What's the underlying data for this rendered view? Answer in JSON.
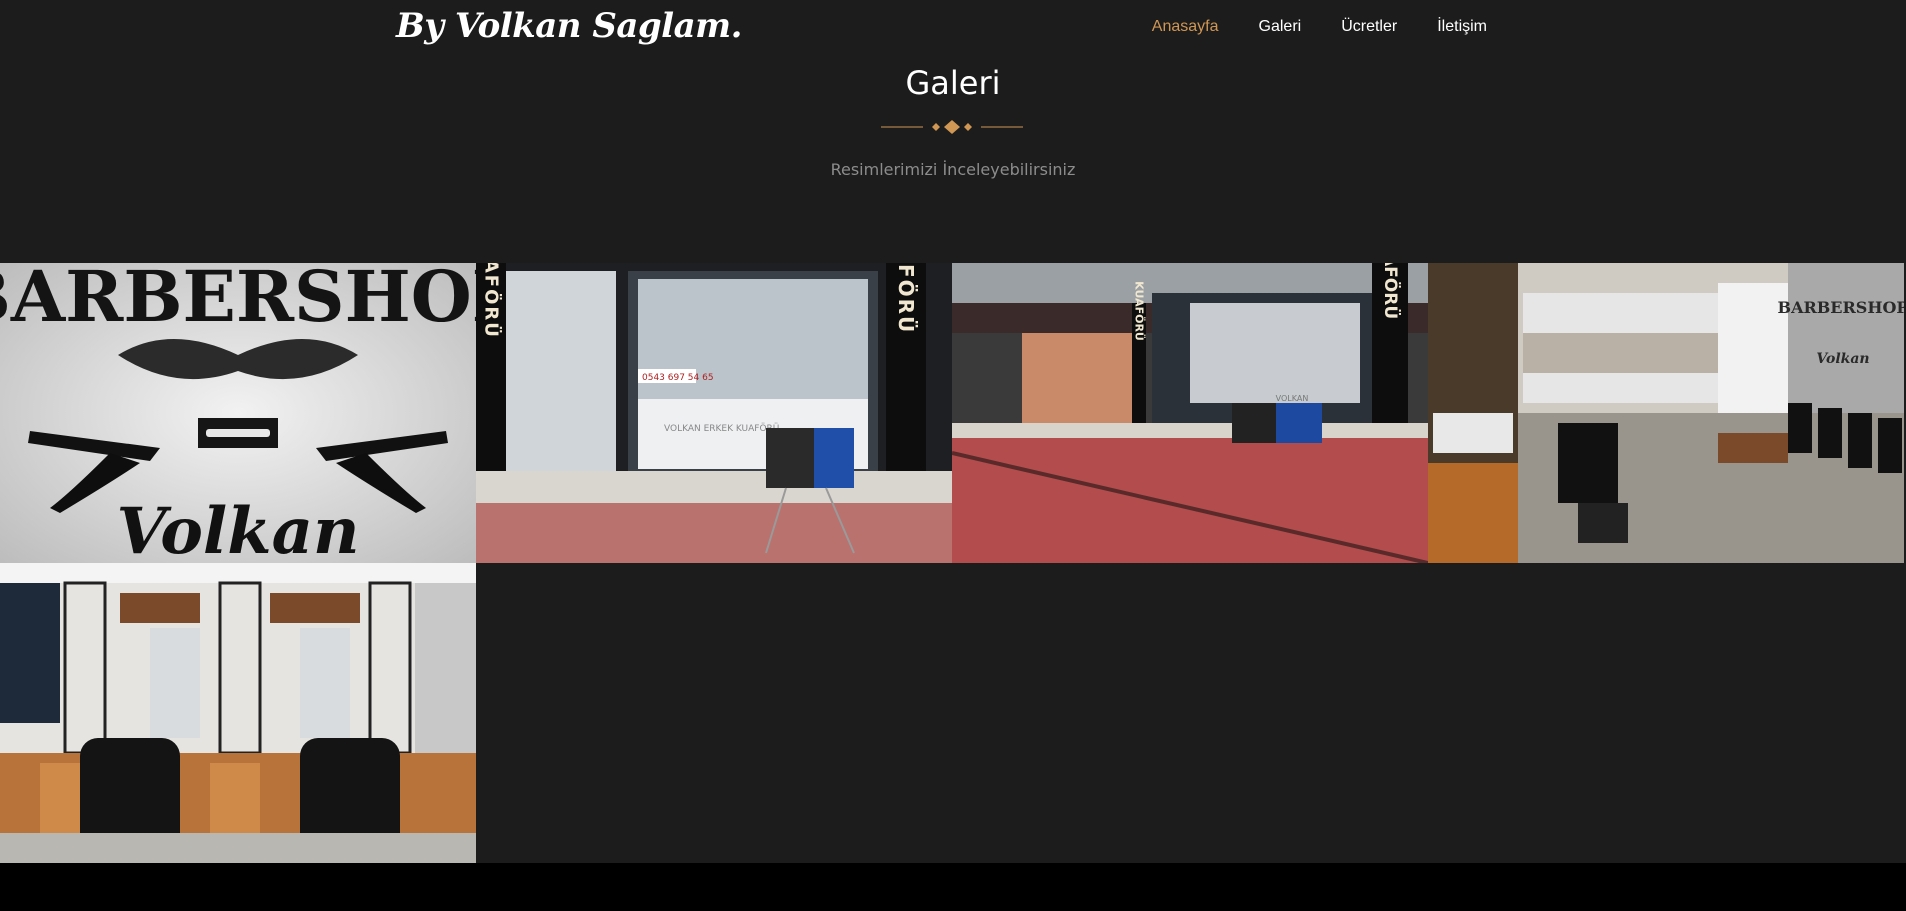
{
  "header": {
    "logo": "By Volkan Saglam.",
    "menu": [
      {
        "label": "Anasayfa",
        "active": true
      },
      {
        "label": "Galeri",
        "active": false
      },
      {
        "label": "Ücretler",
        "active": false
      },
      {
        "label": "İletişim",
        "active": false
      }
    ]
  },
  "gallery": {
    "title": "Galeri",
    "subtitle": "Resimlerimizi İnceleyebilirsiniz",
    "images": [
      {
        "sign_top": "BARBERSHOP",
        "sign_bottom": "Volkan"
      },
      {
        "side_sign": "KUAFÖRÜ",
        "phone": "0543 697 54 65",
        "banner": "VOLKAN ERKEK KUAFÖRÜ"
      },
      {
        "side_sign": "KUAFÖRÜ",
        "banner": "VOLKAN"
      },
      {
        "wall_sign_top": "BARBERSHOP",
        "wall_sign_bottom": "Volkan"
      },
      {}
    ]
  },
  "colors": {
    "accent": "#cf9654",
    "background": "#1c1c1c",
    "footer": "#000000"
  }
}
